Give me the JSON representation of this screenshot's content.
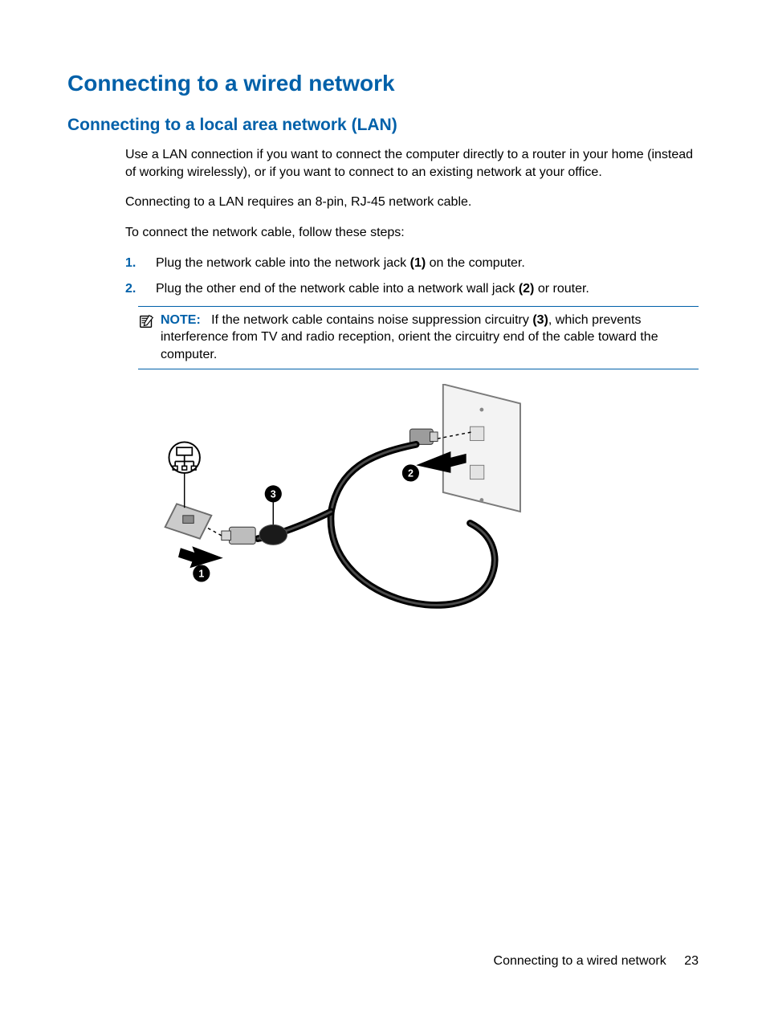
{
  "headings": {
    "h1": "Connecting to a wired network",
    "h2": "Connecting to a local area network (LAN)"
  },
  "paragraphs": {
    "p1": "Use a LAN connection if you want to connect the computer directly to a router in your home (instead of working wirelessly), or if you want to connect to an existing network at your office.",
    "p2": "Connecting to a LAN requires an 8-pin, RJ-45 network cable.",
    "p3": "To connect the network cable, follow these steps:"
  },
  "steps": [
    {
      "pre": "Plug the network cable into the network jack ",
      "bold": "(1)",
      "post": " on the computer."
    },
    {
      "pre": "Plug the other end of the network cable into a network wall jack ",
      "bold": "(2)",
      "post": " or router."
    }
  ],
  "note": {
    "label": "NOTE:",
    "pre": "If the network cable contains noise suppression circuitry ",
    "bold": "(3)",
    "post": ", which prevents interference from TV and radio reception, orient the circuitry end of the cable toward the computer."
  },
  "figure": {
    "callouts": [
      "1",
      "2",
      "3"
    ]
  },
  "footer": {
    "section": "Connecting to a wired network",
    "page": "23"
  }
}
